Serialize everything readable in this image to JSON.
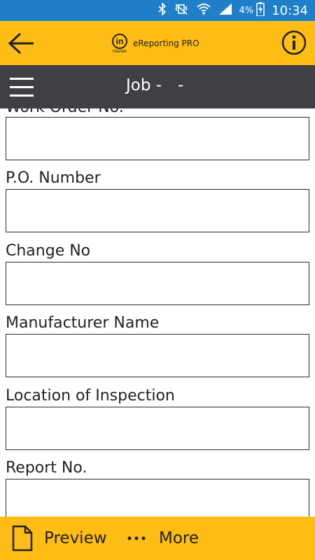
{
  "status_bar": {
    "battery_percent": "4%",
    "time": "10:34",
    "background": "#1f7fc9"
  },
  "app_bar": {
    "logo_mark": "in",
    "logo_subtext": "intertek",
    "app_title": "eReporting PRO",
    "background": "#fdbd14"
  },
  "sub_header": {
    "title": "Job -",
    "title_suffix": "-",
    "background": "#3f4043"
  },
  "form": {
    "partial_label": "Work Order No.",
    "fields": [
      {
        "label": "P.O. Number",
        "value": ""
      },
      {
        "label": "Change No",
        "value": ""
      },
      {
        "label": "Manufacturer Name",
        "value": ""
      },
      {
        "label": "Location of Inspection",
        "value": ""
      },
      {
        "label": "Report No.",
        "value": ""
      }
    ]
  },
  "bottom_bar": {
    "preview_label": "Preview",
    "more_label": "More",
    "preview_icon": "document-icon",
    "more_icon": "more-dots-icon"
  }
}
